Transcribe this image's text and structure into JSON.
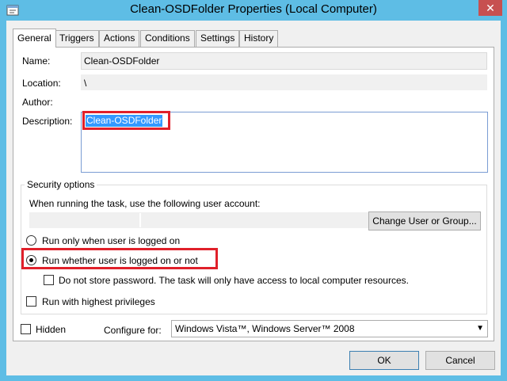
{
  "window": {
    "title": "Clean-OSDFolder Properties (Local Computer)",
    "close_glyph": "✕"
  },
  "tabs": [
    {
      "label": "General",
      "active": true
    },
    {
      "label": "Triggers"
    },
    {
      "label": "Actions"
    },
    {
      "label": "Conditions"
    },
    {
      "label": "Settings"
    },
    {
      "label": "History"
    }
  ],
  "general": {
    "name_label": "Name:",
    "name_value": "Clean-OSDFolder",
    "location_label": "Location:",
    "location_value": "\\",
    "author_label": "Author:",
    "author_value": "",
    "description_label": "Description:",
    "description_value": "Clean-OSDFolder"
  },
  "security": {
    "group_title": "Security options",
    "account_prompt": "When running the task, use the following user account:",
    "account_value": "",
    "change_user_button": "Change User or Group...",
    "radio_logged_on": "Run only when user is logged on",
    "radio_whether": "Run whether user is logged on or not",
    "selected_radio": "whether",
    "no_store_password": "Do not store password.  The task will only have access to local computer resources.",
    "no_store_password_checked": false,
    "highest_privileges": "Run with highest privileges",
    "highest_privileges_checked": false
  },
  "bottom": {
    "hidden_label": "Hidden",
    "hidden_checked": false,
    "configure_label": "Configure for:",
    "configure_value": "Windows Vista™, Windows Server™ 2008"
  },
  "buttons": {
    "ok": "OK",
    "cancel": "Cancel"
  },
  "colors": {
    "titlebar": "#5ebde5",
    "highlight_rect": "#e0202a",
    "selection": "#3399ff"
  }
}
